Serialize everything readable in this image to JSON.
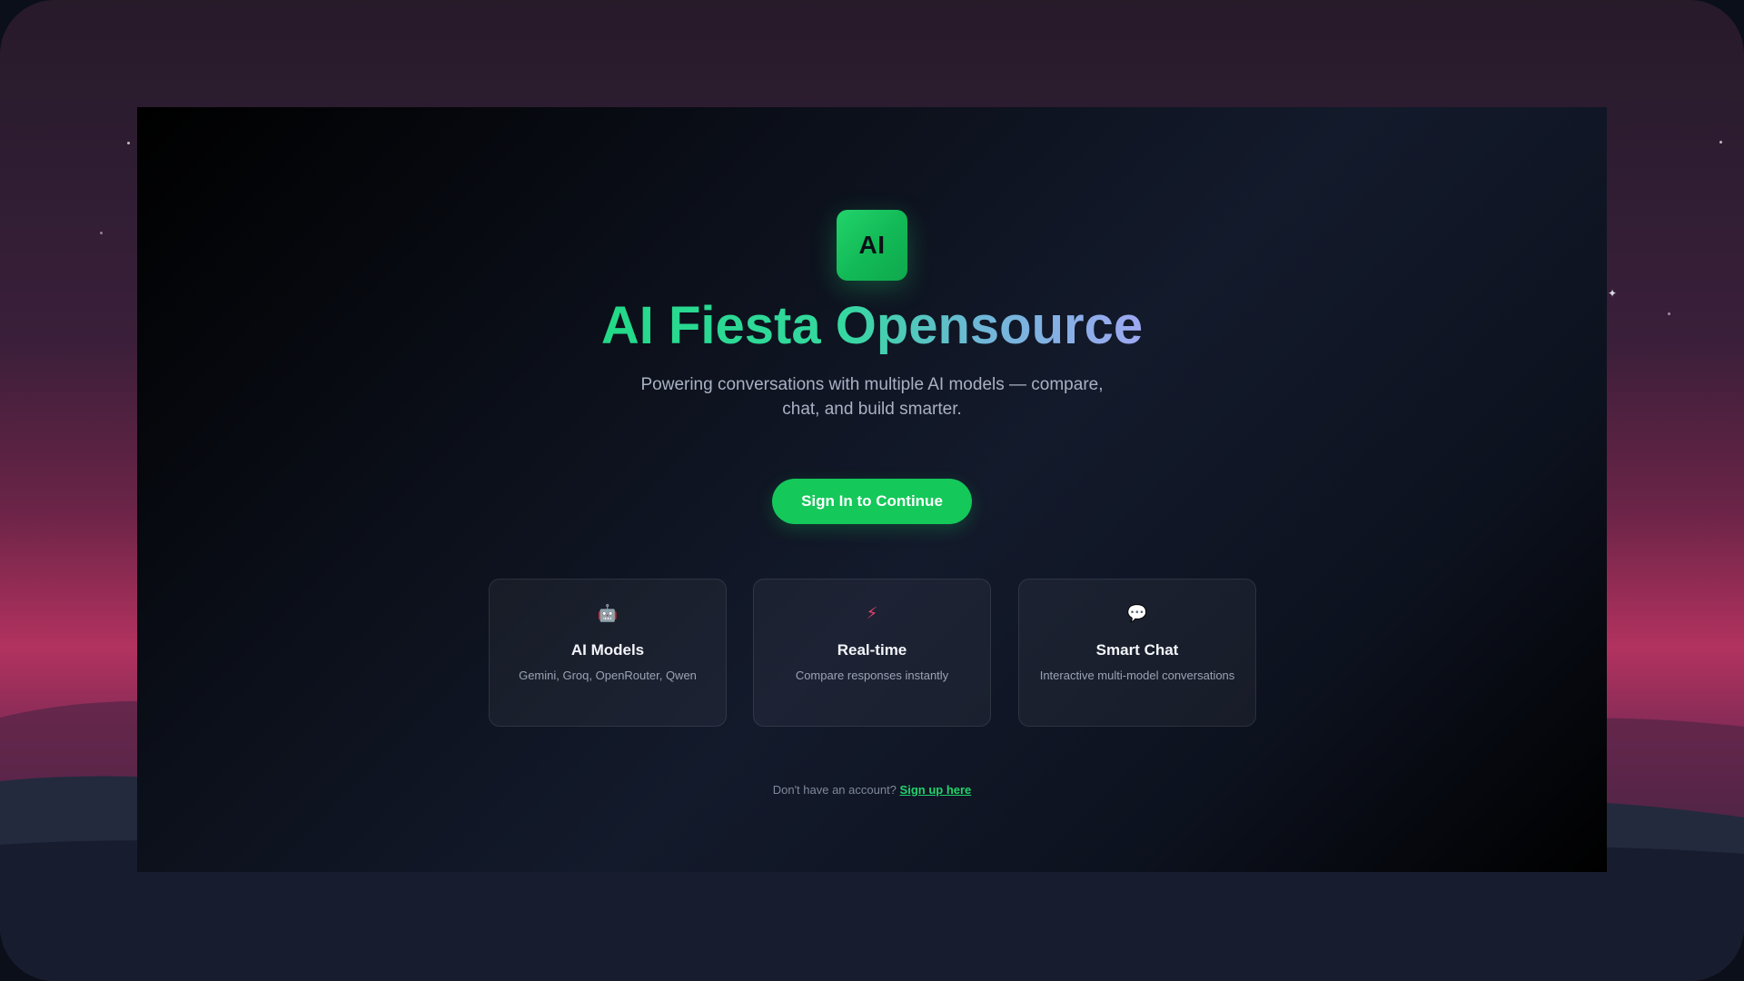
{
  "brand": {
    "logo_text": "AI",
    "title": "AI Fiesta Opensource",
    "subtitle": "Powering conversations with multiple AI models — compare, chat, and build smarter."
  },
  "cta": {
    "label": "Sign In to Continue"
  },
  "features": [
    {
      "icon": "robot-icon",
      "glyph": "🤖",
      "title": "AI Models",
      "description": "Gemini, Groq, OpenRouter, Qwen"
    },
    {
      "icon": "lightning-icon",
      "glyph": "⚡",
      "title": "Real-time",
      "description": "Compare responses instantly"
    },
    {
      "icon": "speech-bubble-icon",
      "glyph": "💬",
      "title": "Smart Chat",
      "description": "Interactive multi-model conversations"
    }
  ],
  "footer": {
    "prompt": "Don't have an account?",
    "link_label": "Sign up here"
  },
  "colors": {
    "accent": "#14c85a",
    "title_gradient_start": "#22d987",
    "title_gradient_end": "#9ea8f1",
    "sunset_pink": "#b2325f"
  }
}
